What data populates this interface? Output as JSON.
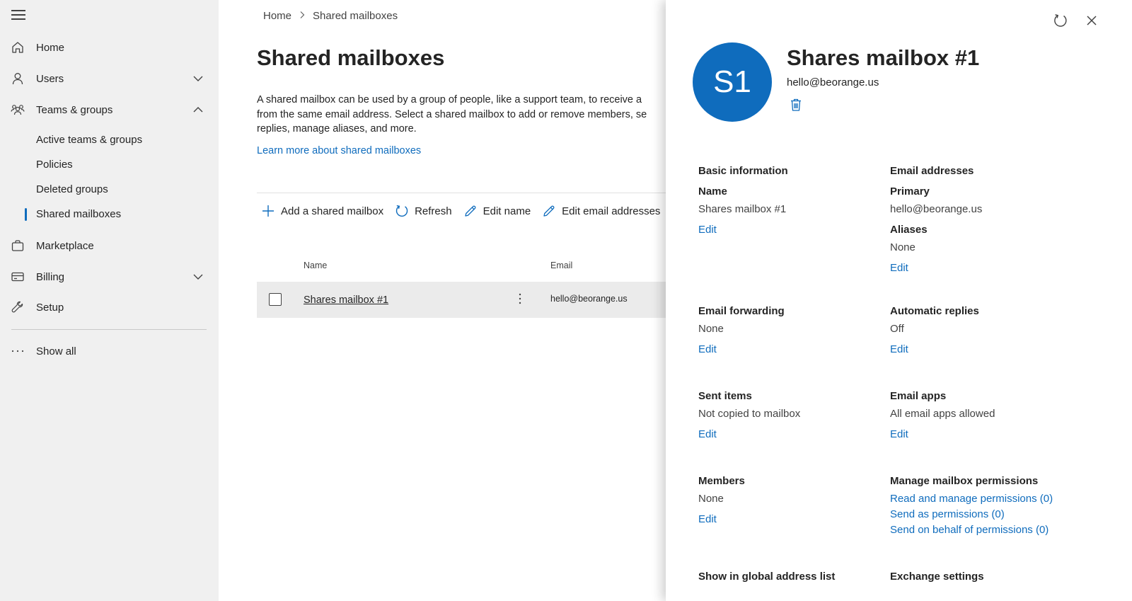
{
  "sidebar": {
    "items": [
      {
        "label": "Home"
      },
      {
        "label": "Users"
      },
      {
        "label": "Teams & groups"
      },
      {
        "label": "Marketplace"
      },
      {
        "label": "Billing"
      },
      {
        "label": "Setup"
      }
    ],
    "sub_items": [
      {
        "label": "Active teams & groups"
      },
      {
        "label": "Policies"
      },
      {
        "label": "Deleted groups"
      },
      {
        "label": "Shared mailboxes"
      }
    ],
    "show_all": "Show all",
    "accent": "#0f6cbd"
  },
  "main": {
    "breadcrumb": {
      "home": "Home",
      "current": "Shared mailboxes"
    },
    "title": "Shared mailboxes",
    "description": "A shared mailbox can be used by a group of people, like a support team, to receive a\nfrom the same email address. Select a shared mailbox to add or remove members, se\nreplies, manage aliases, and more.",
    "learn_link": "Learn more about shared mailboxes",
    "toolbar": {
      "add": "Add a shared mailbox",
      "refresh": "Refresh",
      "edit_name": "Edit name",
      "edit_email": "Edit email addresses"
    },
    "table": {
      "columns": [
        "Name",
        "Email"
      ],
      "rows": [
        {
          "name": "Shares mailbox #1",
          "email": "hello@beorange.us"
        }
      ]
    }
  },
  "panel": {
    "avatar_initials": "S1",
    "title": "Shares mailbox #1",
    "email": "hello@beorange.us",
    "sections": {
      "basic": {
        "heading": "Basic information",
        "sub": "Name",
        "value": "Shares mailbox #1",
        "edit": "Edit"
      },
      "email_addresses": {
        "heading": "Email addresses",
        "primary_label": "Primary",
        "primary_value": "hello@beorange.us",
        "aliases_label": "Aliases",
        "aliases_value": "None",
        "edit": "Edit"
      },
      "forwarding": {
        "heading": "Email forwarding",
        "value": "None",
        "edit": "Edit"
      },
      "auto_replies": {
        "heading": "Automatic replies",
        "value": "Off",
        "edit": "Edit"
      },
      "sent_items": {
        "heading": "Sent items",
        "value": "Not copied to mailbox",
        "edit": "Edit"
      },
      "email_apps": {
        "heading": "Email apps",
        "value": "All email apps allowed",
        "edit": "Edit"
      },
      "members": {
        "heading": "Members",
        "value": "None",
        "edit": "Edit"
      },
      "permissions": {
        "heading": "Manage mailbox permissions",
        "links": [
          "Read and manage permissions (0)",
          "Send as permissions (0)",
          "Send on behalf of permissions (0)"
        ]
      },
      "gal": {
        "heading": "Show in global address list"
      },
      "exchange": {
        "heading": "Exchange settings"
      }
    }
  }
}
